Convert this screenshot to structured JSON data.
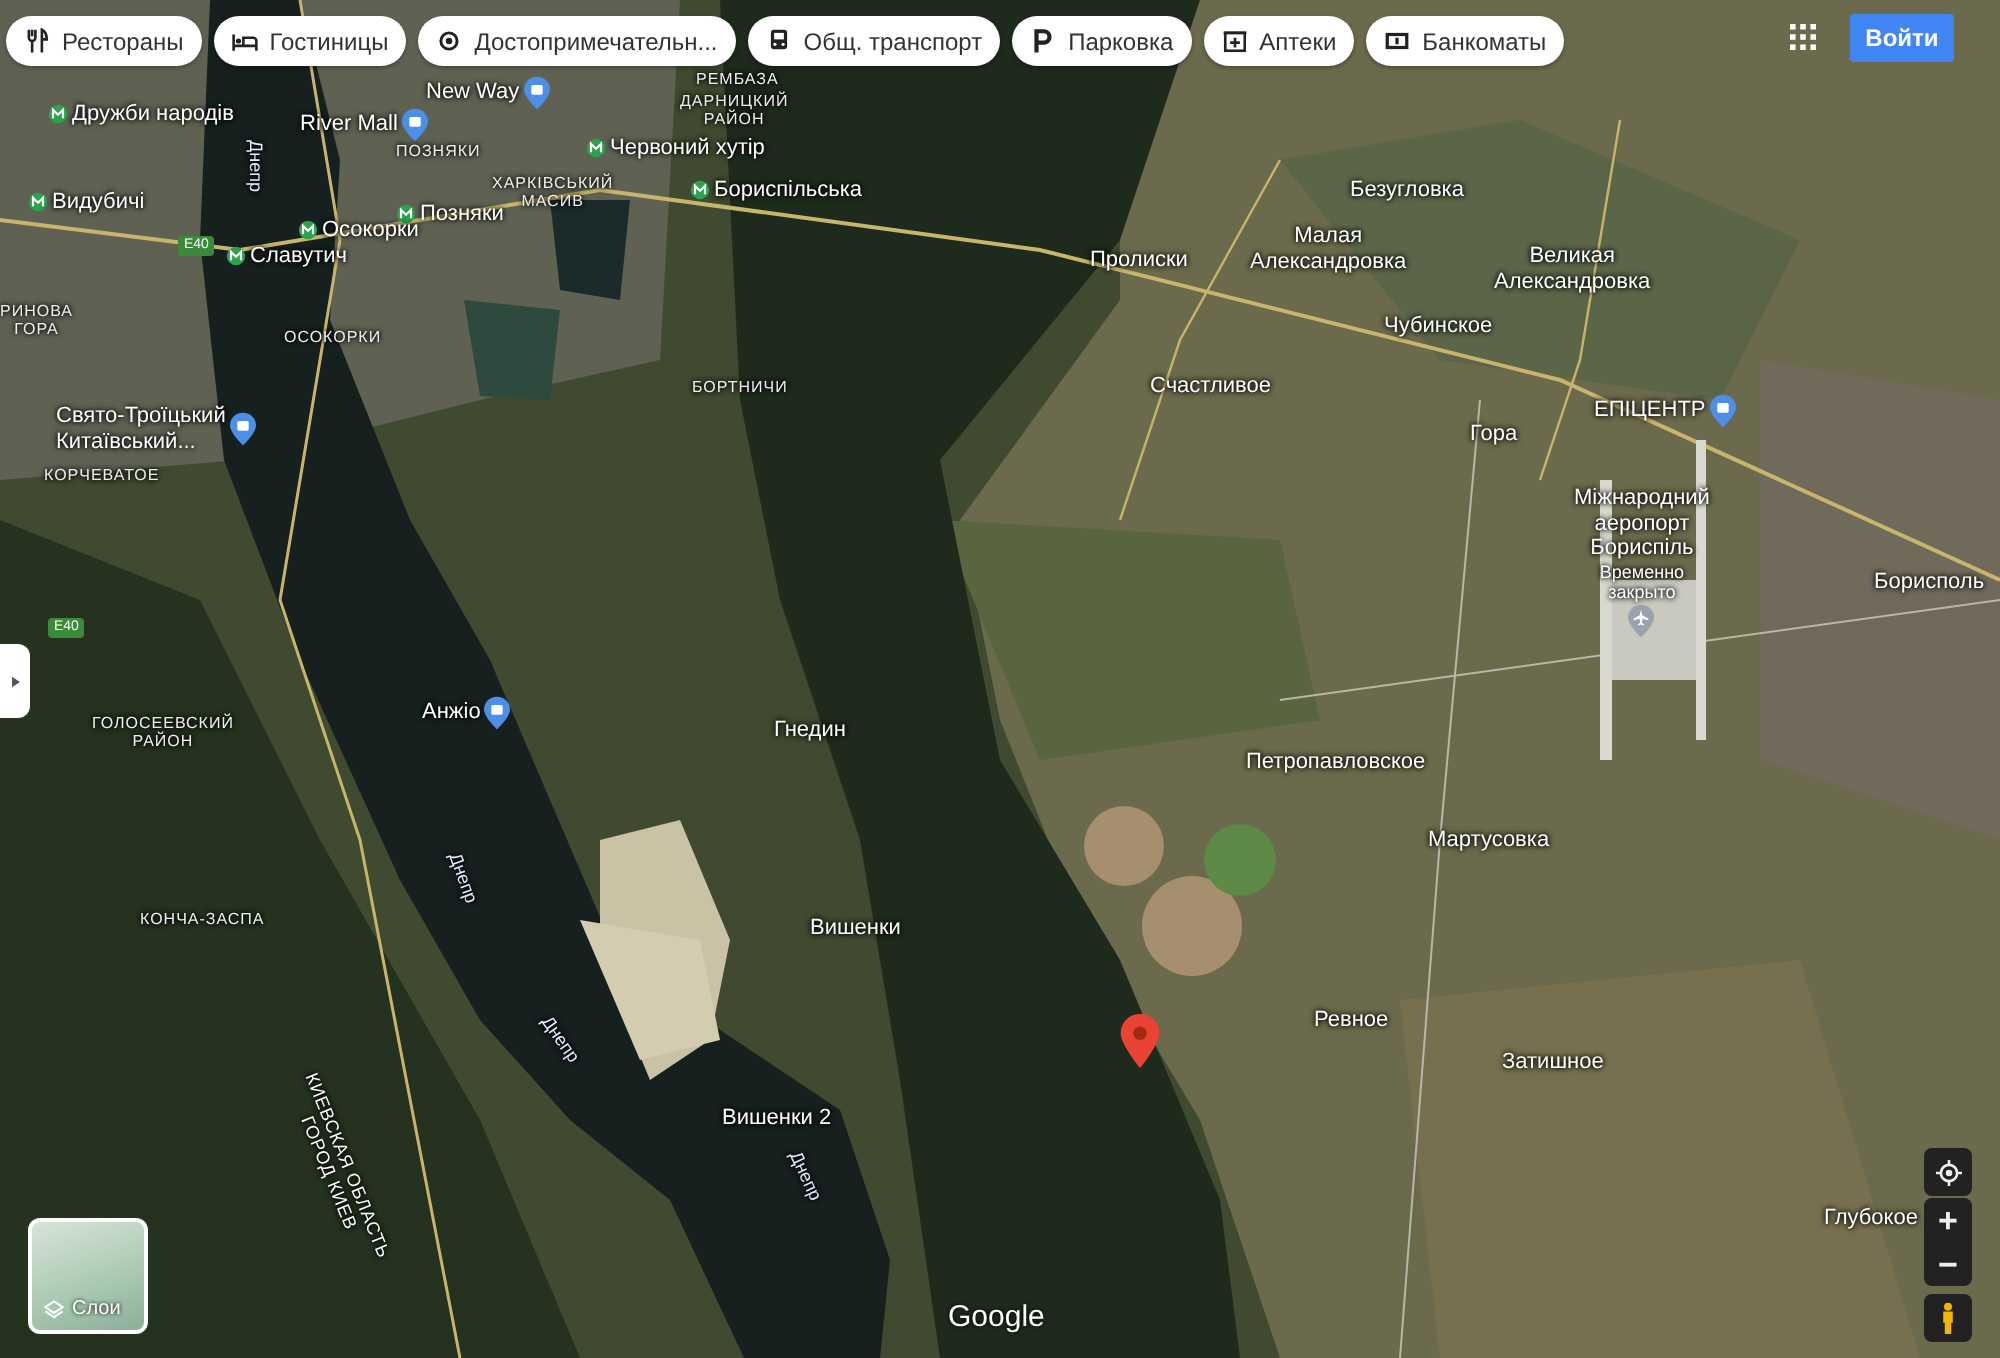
{
  "chips": [
    {
      "label": "Рестораны"
    },
    {
      "label": "Гостиницы"
    },
    {
      "label": "Достопримечательн..."
    },
    {
      "label": "Общ. транспорт"
    },
    {
      "label": "Парковка"
    },
    {
      "label": "Аптеки"
    },
    {
      "label": "Банкоматы"
    }
  ],
  "sign_in": "Войти",
  "map_labels": [
    {
      "kind": "poi",
      "text": "New Way"
    },
    {
      "kind": "district",
      "text": "РЕМБАЗА"
    },
    {
      "kind": "metro",
      "text": "Дружби народів"
    },
    {
      "kind": "poi",
      "text": "River Mall"
    },
    {
      "kind": "district",
      "text": "ДАРНИЦКИЙ\nРАЙОН"
    },
    {
      "kind": "district",
      "text": "ПОЗНЯКИ"
    },
    {
      "kind": "metro",
      "text": "Червоний хутір"
    },
    {
      "kind": "district",
      "text": "ХАРКІВСЬКИЙ\nМАСИВ"
    },
    {
      "kind": "metro",
      "text": "Бориспільська"
    },
    {
      "kind": "metro",
      "text": "Видубичі"
    },
    {
      "kind": "metro",
      "text": "Позняки"
    },
    {
      "kind": "metro",
      "text": "Осокорки"
    },
    {
      "kind": "metro",
      "text": "Славутич"
    },
    {
      "kind": "road",
      "text": "E40"
    },
    {
      "kind": "road",
      "text": "E40"
    },
    {
      "kind": "district",
      "text": "ОСОКОРКИ"
    },
    {
      "kind": "district",
      "text": "БОРТНИЧИ"
    },
    {
      "kind": "district",
      "text": "РИНОВА\nГОРА"
    },
    {
      "kind": "poi",
      "text": "Свято-Троїцький\nКитаївський..."
    },
    {
      "kind": "district",
      "text": "КОРЧЕВАТОЕ"
    },
    {
      "kind": "place",
      "text": "Пролиски"
    },
    {
      "kind": "place",
      "text": "Малая\nАлександровка"
    },
    {
      "kind": "place",
      "text": "Безугловка"
    },
    {
      "kind": "place",
      "text": "Великая\nАлександровка"
    },
    {
      "kind": "place",
      "text": "Чубинское"
    },
    {
      "kind": "place",
      "text": "Счастливое"
    },
    {
      "kind": "place",
      "text": "Гора"
    },
    {
      "kind": "poi",
      "text": "ЕПІЦЕНТР"
    },
    {
      "kind": "airport",
      "text": "Міжнародний\nаеропорт\nБориспіль",
      "note": "Временно\nзакрыто"
    },
    {
      "kind": "place",
      "text": "Борисполь"
    },
    {
      "kind": "poi",
      "text": "Анжіо"
    },
    {
      "kind": "place",
      "text": "Гнедин"
    },
    {
      "kind": "district",
      "text": "ГОЛОСЕЕВСКИЙ\nРАЙОН"
    },
    {
      "kind": "district",
      "text": "КОНЧА-ЗАСПА"
    },
    {
      "kind": "place",
      "text": "Петропавловское"
    },
    {
      "kind": "place",
      "text": "Мартусовка"
    },
    {
      "kind": "river",
      "text": "Днепр"
    },
    {
      "kind": "river",
      "text": "Днепр"
    },
    {
      "kind": "river",
      "text": "Днепр"
    },
    {
      "kind": "river",
      "text": "Днепр"
    },
    {
      "kind": "place",
      "text": "Вишенки"
    },
    {
      "kind": "place",
      "text": "Вишенки 2"
    },
    {
      "kind": "boundary",
      "text": "КИЕВСКАЯ ОБЛАСТЬ\nГОРОД КИЕВ"
    },
    {
      "kind": "place",
      "text": "Ревное"
    },
    {
      "kind": "place",
      "text": "Затишное"
    },
    {
      "kind": "place",
      "text": "Глубокое"
    }
  ],
  "logo": "Google",
  "layers": {
    "label": "Слои"
  },
  "zoom": {
    "in": "+",
    "out": "−"
  }
}
